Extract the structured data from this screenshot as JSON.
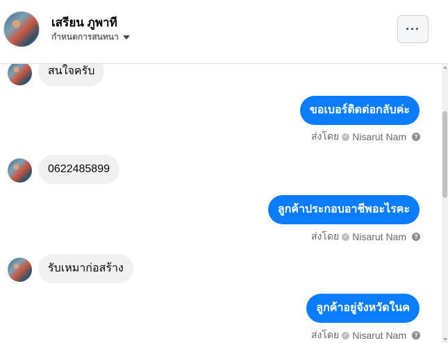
{
  "header": {
    "name": "เสรียน ภูพาที",
    "subtitle": "กำหนดการสนทนา",
    "more_icon": "more-horizontal-icon"
  },
  "messages": [
    {
      "direction": "incoming",
      "text": "สนใจครับ"
    },
    {
      "direction": "outgoing",
      "text": "ขอเบอร์ติดต่อกลับค่ะ",
      "sent_by_label": "ส่งโดย",
      "sender": "Nisarut Nam"
    },
    {
      "direction": "incoming",
      "text": "0622485899"
    },
    {
      "direction": "outgoing",
      "text": "ลูกค้าประกอบอาชีพอะไรคะ",
      "sent_by_label": "ส่งโดย",
      "sender": "Nisarut Nam"
    },
    {
      "direction": "incoming",
      "text": "รับเหมาก่อสร้าง"
    },
    {
      "direction": "outgoing",
      "text": "ลูกค้าอยู่จังหวัดในค",
      "sent_by_label": "ส่งโดย",
      "sender": "Nisarut Nam"
    }
  ],
  "colors": {
    "outgoing_bubble": "#0a7cff",
    "incoming_bubble": "#f0f0f0"
  }
}
